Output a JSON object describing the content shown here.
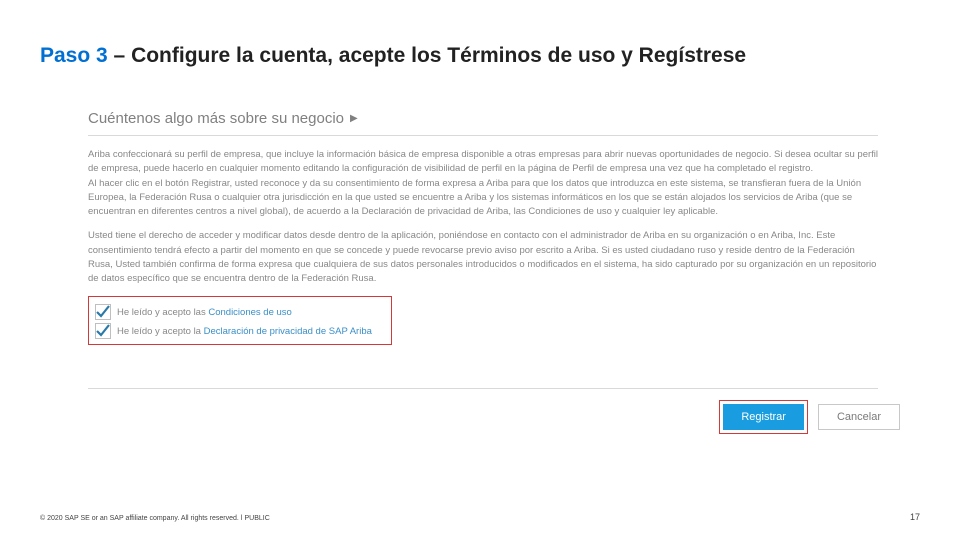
{
  "title": {
    "step": "Paso 3",
    "rest": " – Configure la cuenta, acepte los Términos de uso y Regístrese"
  },
  "section_header": "Cuéntenos algo más sobre su negocio",
  "paragraphs": {
    "p1a": "Ariba confeccionará su perfil de empresa, que incluye la información básica de empresa disponible a otras empresas para abrir nuevas oportunidades de negocio. Si desea ocultar su perfil de empresa, puede hacerlo en cualquier momento editando la configuración de visibilidad de perfil en la página de Perfil de empresa una vez que ha completado el registro.",
    "p1b": "Al hacer clic en el botón Registrar, usted reconoce y da su consentimiento de forma expresa a Ariba para que los datos que introduzca en este sistema, se transfieran fuera de la Unión Europea, la Federación Rusa o cualquier otra jurisdicción en la que usted se encuentre a Ariba y los sistemas informáticos en los que se están alojados los servicios de Ariba (que se encuentran en diferentes centros a nivel global), de acuerdo a la Declaración de privacidad de Ariba, las Condiciones de uso y cualquier ley aplicable.",
    "p2": "Usted tiene el derecho de acceder y modificar datos desde dentro de la aplicación, poniéndose en contacto con el administrador de Ariba en su organización o en Ariba, Inc. Este consentimiento tendrá efecto a partir del momento en que se concede y puede revocarse previo aviso por escrito a Ariba. Si es usted ciudadano ruso y reside dentro de la Federación Rusa, Usted también confirma de forma expresa que cualquiera de sus datos personales introducidos o modificados en el sistema, ha sido capturado por su organización en un repositorio de datos específico que se encuentra dentro de la Federación Rusa."
  },
  "checkbox1": {
    "prefix": "He leído y acepto las ",
    "link": "Condiciones de uso"
  },
  "checkbox2": {
    "prefix": "He leído y acepto la ",
    "link": "Declaración de privacidad de SAP Ariba"
  },
  "buttons": {
    "register": "Registrar",
    "cancel": "Cancelar"
  },
  "footer": "© 2020 SAP SE or an SAP affiliate company. All rights reserved. ǀ PUBLIC",
  "page_number": "17"
}
